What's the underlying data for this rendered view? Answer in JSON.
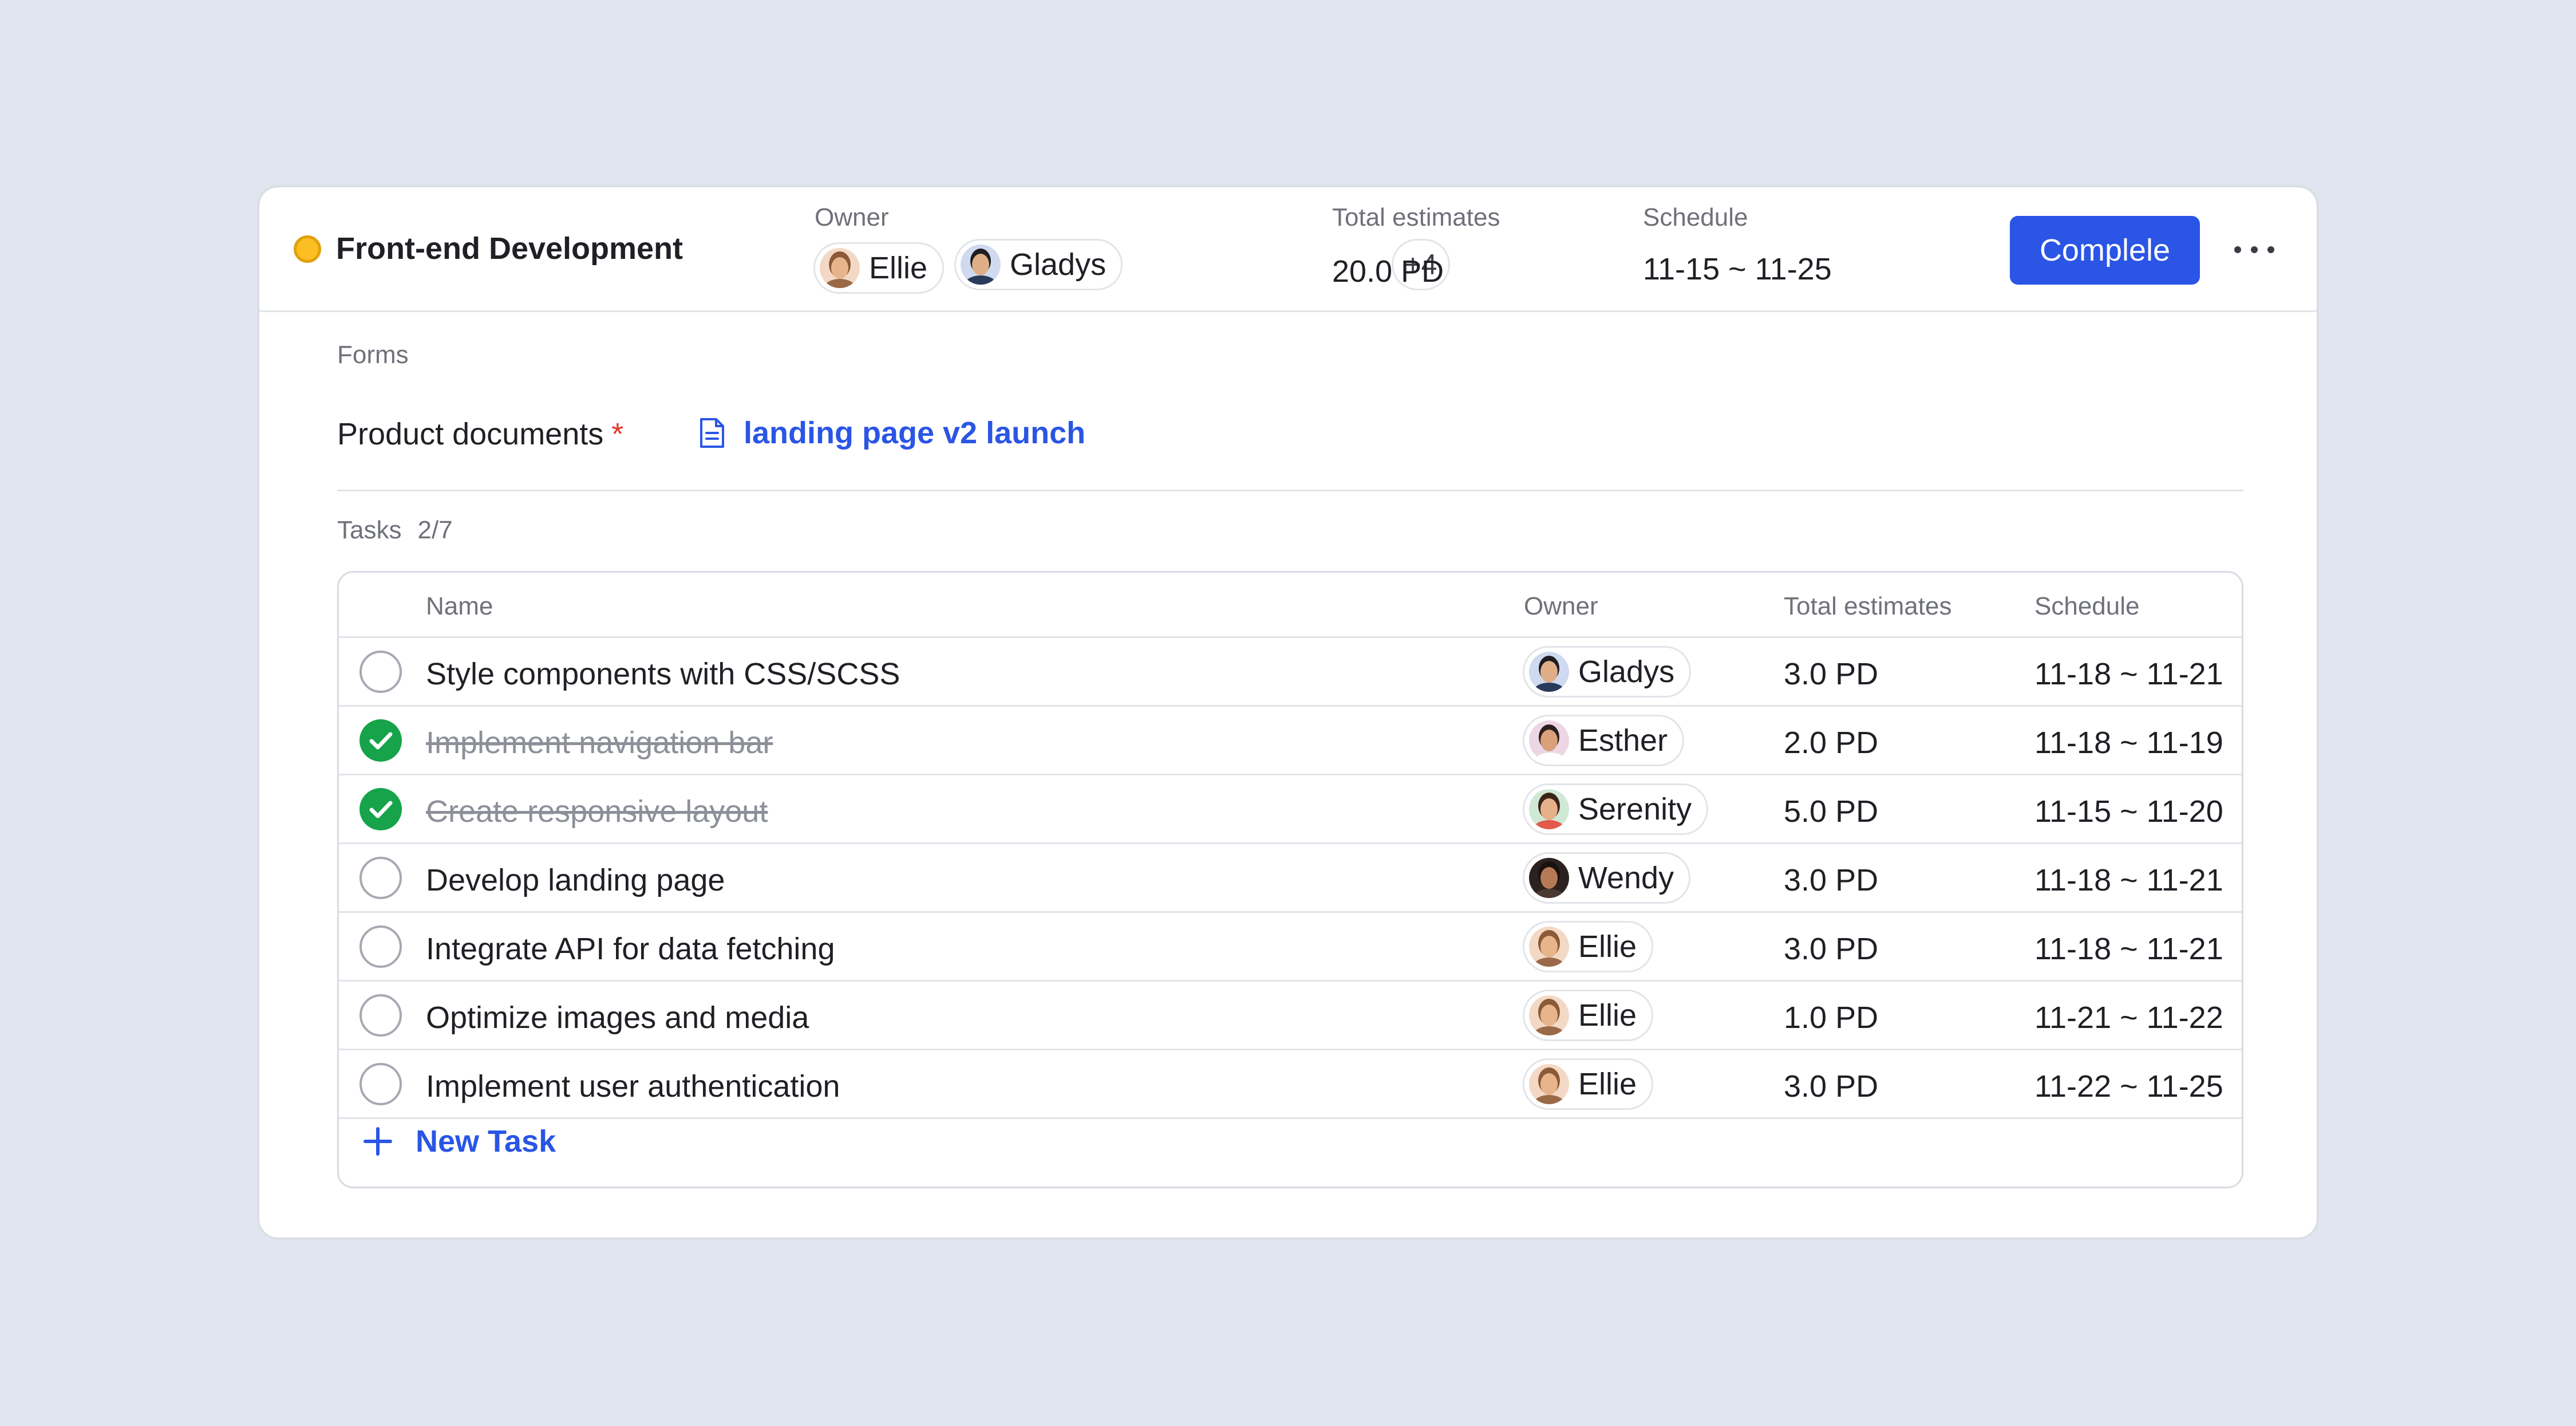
{
  "project": {
    "title": "Front-end Development",
    "status_color": "#fbbf24"
  },
  "header": {
    "owner_label": "Owner",
    "owners": [
      {
        "name": "Ellie"
      },
      {
        "name": "Gladys"
      }
    ],
    "more_owners": "+4",
    "estimates_label": "Total estimates",
    "estimates_value": "20.0 PD",
    "schedule_label": "Schedule",
    "schedule_value": "11-15 ~ 11-25",
    "complete_button": "Complele",
    "more_icon": "more-horizontal-icon"
  },
  "forms": {
    "section_label": "Forms",
    "field_label": "Product documents",
    "required_mark": "*",
    "document_icon": "document-icon",
    "document_link": "landing page v2 launch"
  },
  "tasks": {
    "section_label": "Tasks",
    "count": "2/7",
    "columns": {
      "name": "Name",
      "owner": "Owner",
      "estimates": "Total estimates",
      "schedule": "Schedule"
    },
    "rows": [
      {
        "name": "Style components with CSS/SCSS",
        "done": false,
        "owner": "Gladys",
        "estimate": "3.0 PD",
        "schedule": "11-18 ~ 11-21"
      },
      {
        "name": "Implement navigation bar",
        "done": true,
        "owner": "Esther",
        "estimate": "2.0 PD",
        "schedule": "11-18 ~ 11-19"
      },
      {
        "name": "Create responsive layout",
        "done": true,
        "owner": "Serenity",
        "estimate": "5.0 PD",
        "schedule": "11-15 ~ 11-20"
      },
      {
        "name": "Develop landing page",
        "done": false,
        "owner": "Wendy",
        "estimate": "3.0 PD",
        "schedule": "11-18 ~ 11-21"
      },
      {
        "name": "Integrate API for data fetching",
        "done": false,
        "owner": "Ellie",
        "estimate": "3.0 PD",
        "schedule": "11-18 ~ 11-21"
      },
      {
        "name": "Optimize images and media",
        "done": false,
        "owner": "Ellie",
        "estimate": "1.0 PD",
        "schedule": "11-21 ~ 11-22"
      },
      {
        "name": "Implement user authentication",
        "done": false,
        "owner": "Ellie",
        "estimate": "3.0 PD",
        "schedule": "11-22 ~ 11-25"
      }
    ],
    "new_task_label": "New Task",
    "new_task_icon": "plus-icon"
  },
  "colors": {
    "accent": "#2a55e5",
    "done_green": "#16a34a",
    "required_red": "#e5352b",
    "background": "#e1e5ef"
  }
}
